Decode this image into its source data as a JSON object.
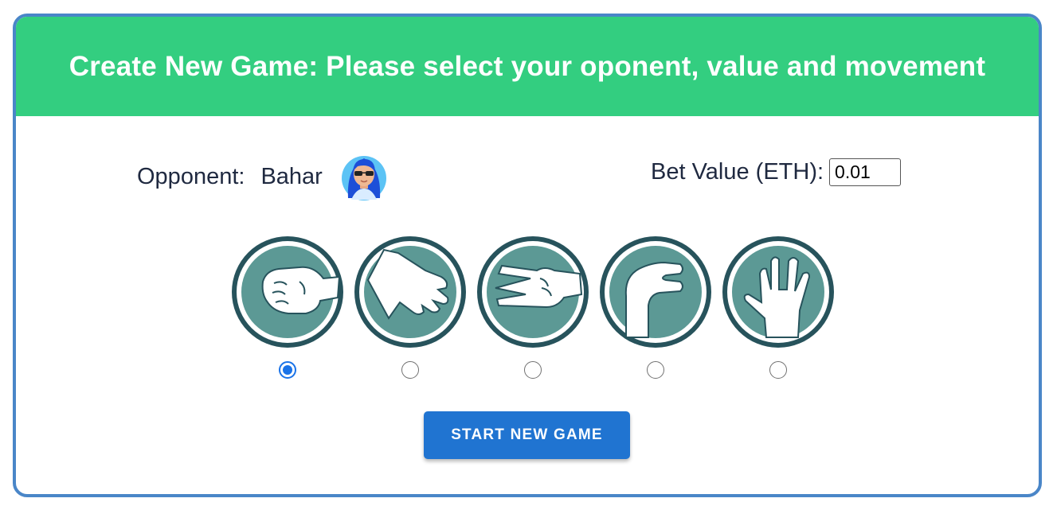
{
  "header": {
    "title": "Create New Game: Please select your oponent, value and movement"
  },
  "opponent": {
    "label": "Opponent:",
    "name": "Bahar",
    "avatar_icon": "avatar-woman-sunglasses-icon"
  },
  "bet": {
    "label": "Bet Value (ETH):",
    "value": "0.01"
  },
  "moves": [
    {
      "name": "rock",
      "icon": "rock-hand-icon",
      "selected": true
    },
    {
      "name": "paper",
      "icon": "paper-hand-icon",
      "selected": false
    },
    {
      "name": "scissors",
      "icon": "scissors-hand-icon",
      "selected": false
    },
    {
      "name": "lizard",
      "icon": "lizard-hand-icon",
      "selected": false
    },
    {
      "name": "spock",
      "icon": "spock-hand-icon",
      "selected": false
    }
  ],
  "actions": {
    "start_label": "START NEW GAME"
  },
  "colors": {
    "header_bg": "#33ce80",
    "card_border": "#4a86c8",
    "button_bg": "#2074d1",
    "icon_fill": "#5c9995",
    "icon_ring": "#27535c",
    "radio_checked": "#1a73e8"
  }
}
